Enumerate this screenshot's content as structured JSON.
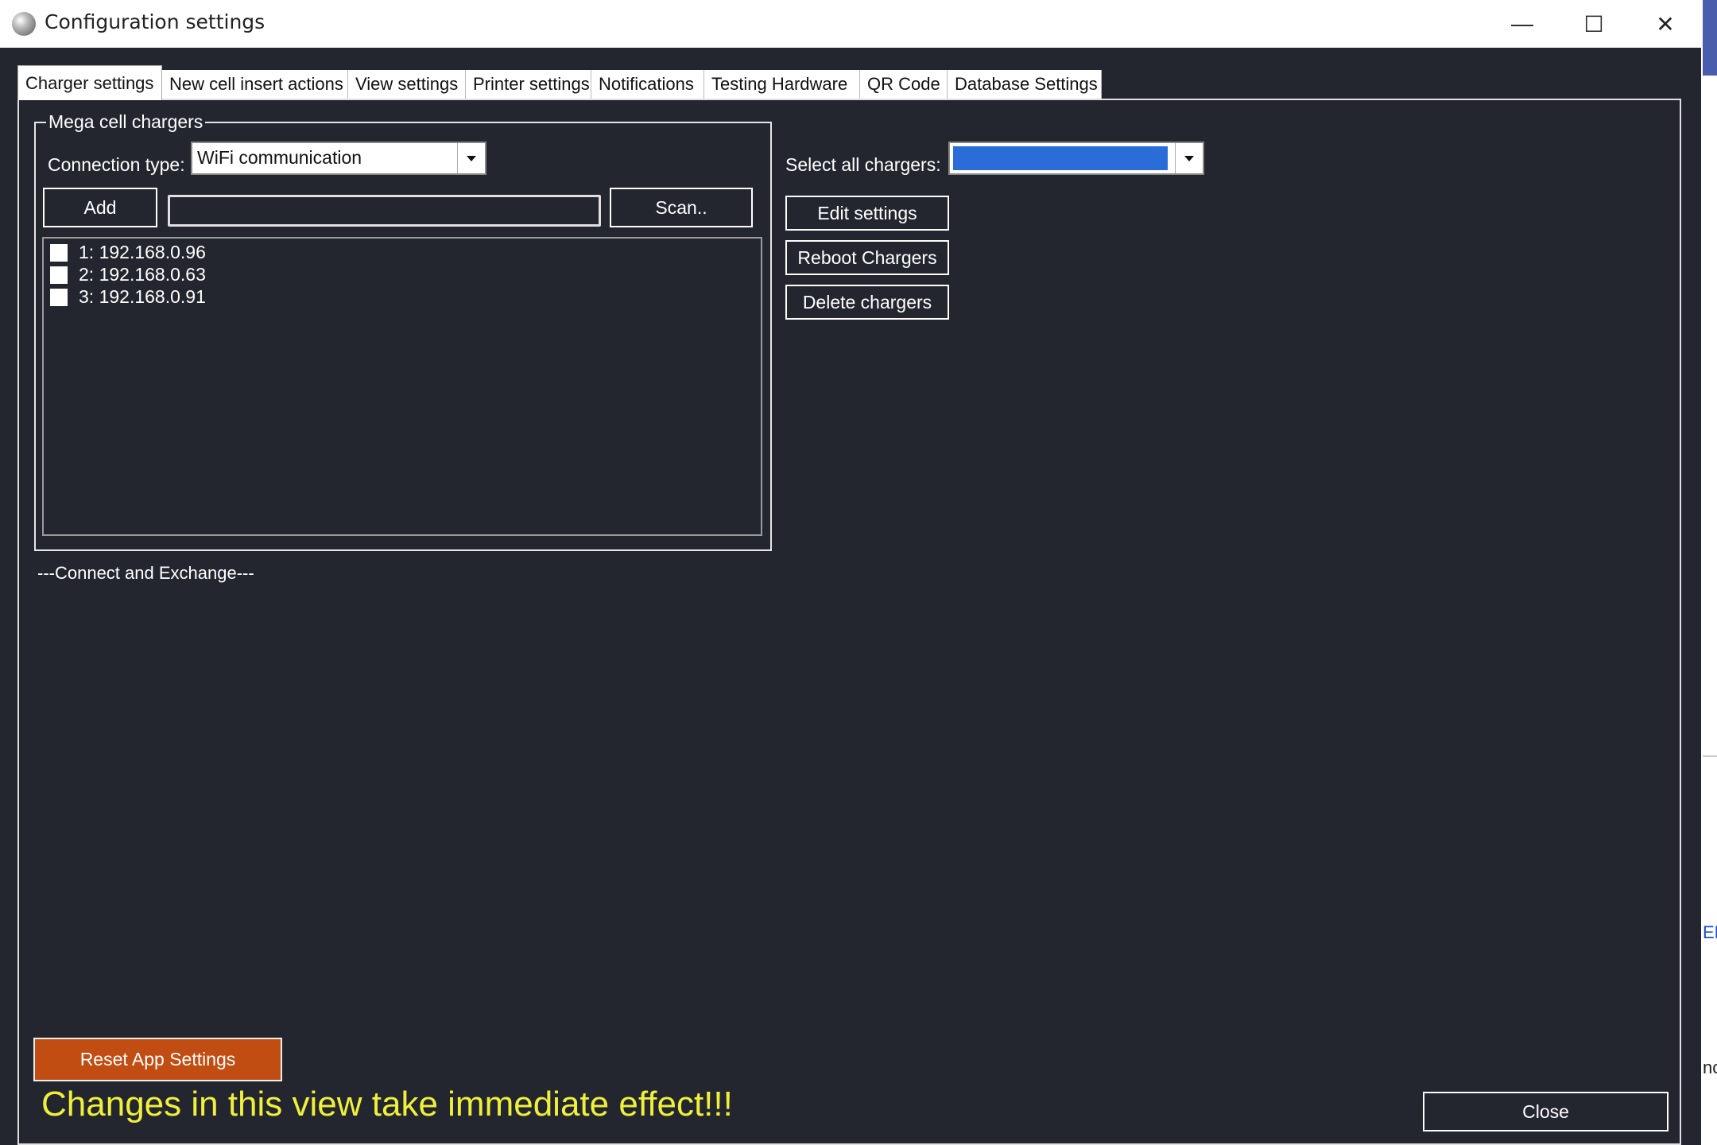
{
  "window": {
    "title": "Configuration settings",
    "minimize_glyph": "—",
    "maximize_glyph": "☐",
    "close_glyph": "✕"
  },
  "tabs": [
    {
      "label": "Charger settings",
      "active": true
    },
    {
      "label": "New cell insert actions",
      "active": false
    },
    {
      "label": "View settings",
      "active": false
    },
    {
      "label": "Printer settings",
      "active": false
    },
    {
      "label": "Notifications",
      "active": false
    },
    {
      "label": "Testing Hardware",
      "active": false
    },
    {
      "label": "QR Code",
      "active": false
    },
    {
      "label": "Database Settings",
      "active": false
    }
  ],
  "group": {
    "legend": "Mega cell chargers",
    "connection_label": "Connection type:",
    "connection_value": "WiFi communication",
    "add_label": "Add",
    "scan_input_value": "",
    "scan_label": "Scan..",
    "chargers": [
      {
        "label": "1: 192.168.0.96",
        "checked": false
      },
      {
        "label": "2: 192.168.0.63",
        "checked": false
      },
      {
        "label": "3: 192.168.0.91",
        "checked": false
      }
    ]
  },
  "right": {
    "select_all_label": "Select all chargers:",
    "select_all_value": "",
    "select_all_fill": "#2a6dd9",
    "edit_label": "Edit settings",
    "reboot_label": "Reboot Chargers",
    "delete_label": "Delete chargers"
  },
  "status": "---Connect and Exchange---",
  "footer": {
    "reset_label": "Reset App Settings",
    "warning": "Changes in this view take immediate effect!!!",
    "close_label": "Close"
  },
  "colors": {
    "background": "#23262f",
    "reset_button": "#c24d12",
    "warning_text": "#f0f03a"
  },
  "outside": {
    "link_text": "ED",
    "edge_text": "nc"
  }
}
